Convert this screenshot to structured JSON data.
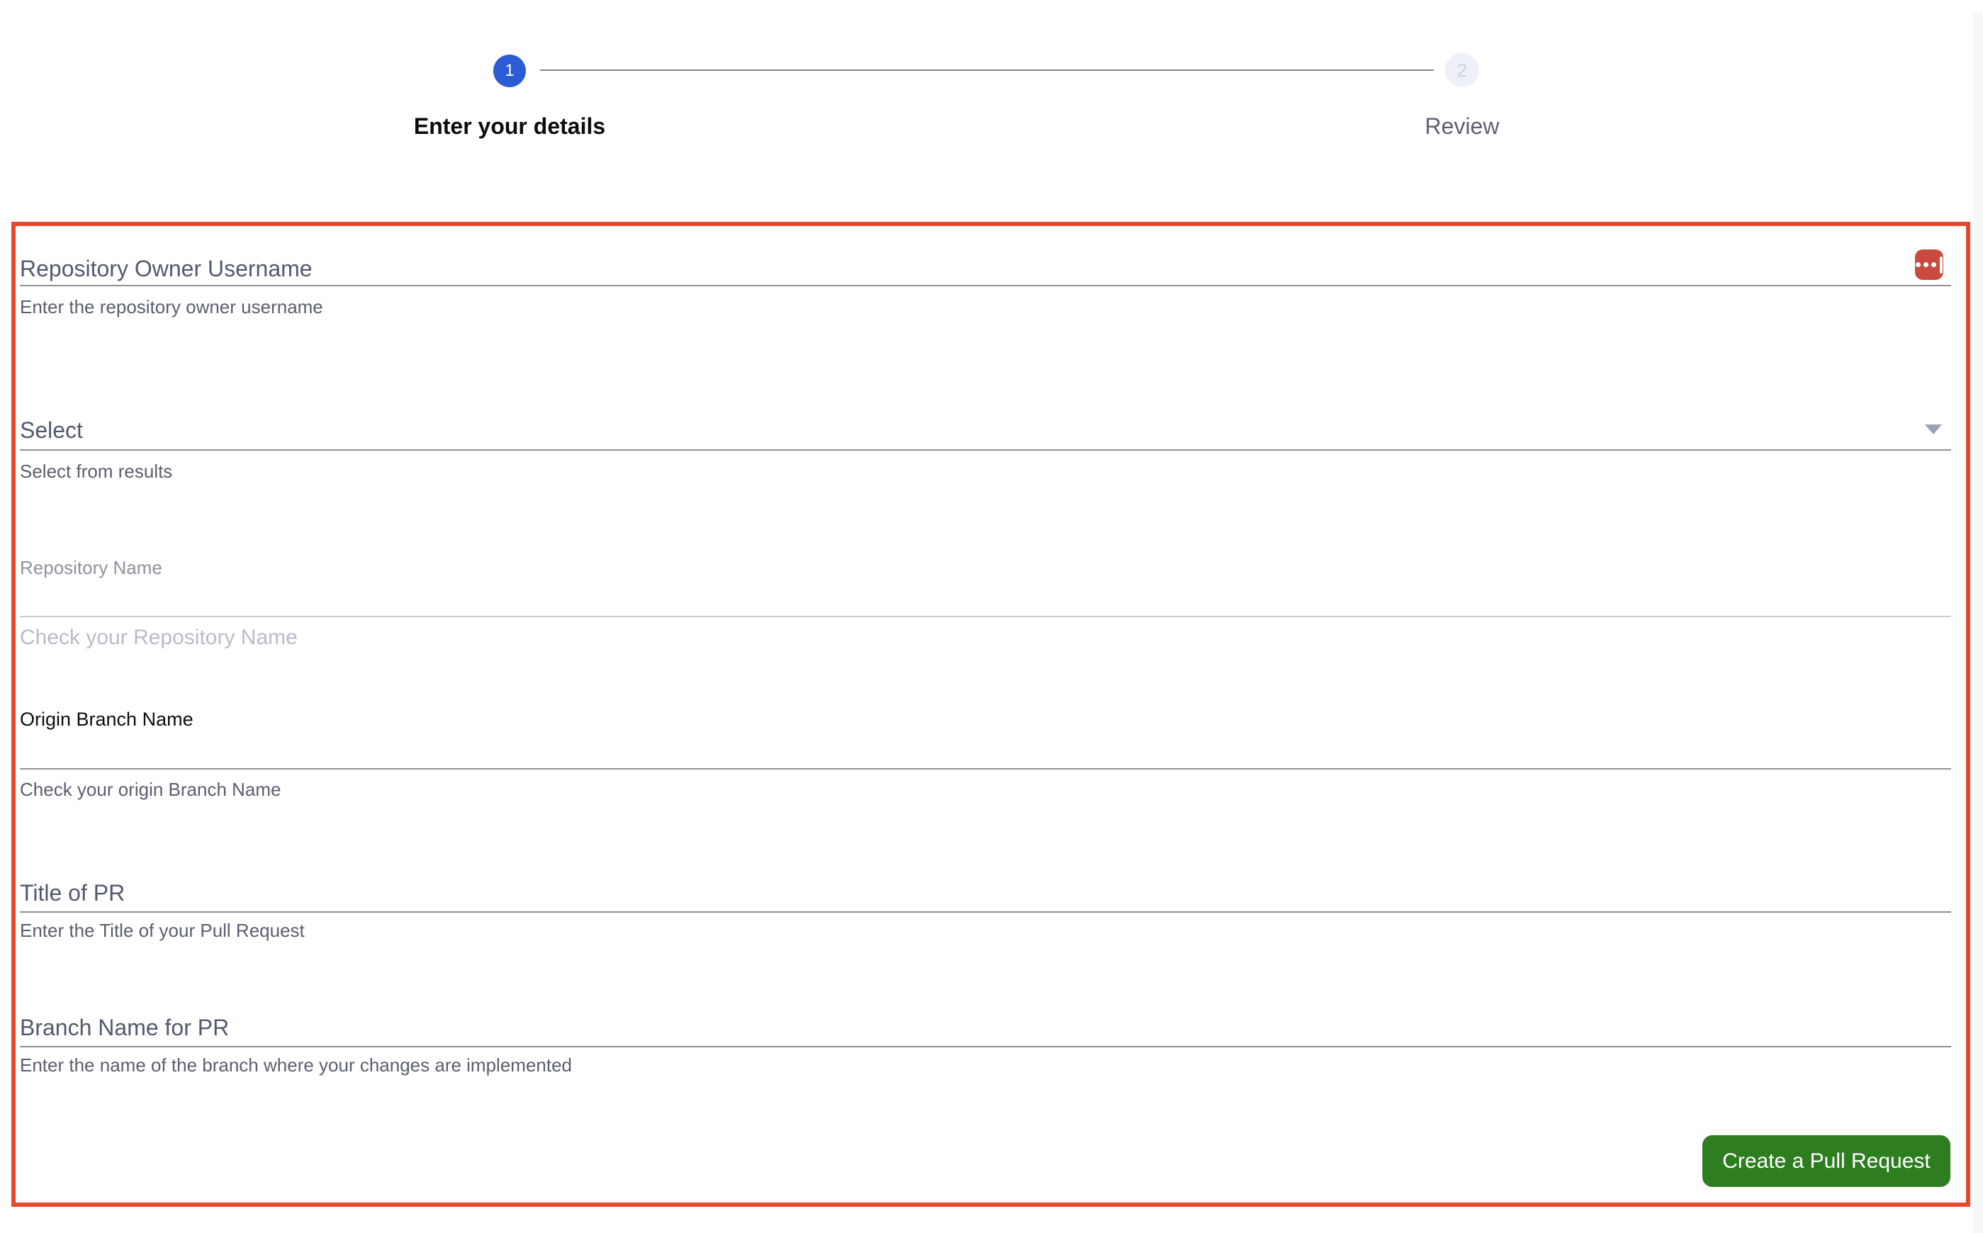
{
  "stepper": {
    "steps": [
      {
        "number": "1",
        "label": "Enter your details",
        "state": "active"
      },
      {
        "number": "2",
        "label": "Review",
        "state": "inactive"
      }
    ],
    "active_color": "#2b5cd3",
    "inactive_color": "#eef0f7"
  },
  "form": {
    "highlight_border_color": "#e8472a",
    "fields": [
      {
        "label": "Repository Owner Username",
        "helper": "Enter the repository owner username",
        "type": "text",
        "state": "empty"
      },
      {
        "label": "Select",
        "helper": "Select from results",
        "type": "select",
        "state": "empty"
      },
      {
        "label": "Repository Name",
        "helper": "Check your Repository Name",
        "type": "text",
        "state": "disabled"
      },
      {
        "label": "Origin Branch Name",
        "helper": "Check your origin Branch Name",
        "type": "text",
        "state": "empty"
      },
      {
        "label": "Title of PR",
        "helper": "Enter the Title of your Pull Request",
        "type": "text",
        "state": "empty"
      },
      {
        "label": "Branch Name for PR",
        "helper": "Enter the name of the branch where your changes are implemented",
        "type": "text",
        "state": "empty"
      }
    ],
    "submit": {
      "label": "Create a Pull Request",
      "color": "#2e7d21"
    }
  },
  "icons": {
    "password_manager": "lastpass-icon",
    "select_chevron": "chevron-down-icon"
  }
}
